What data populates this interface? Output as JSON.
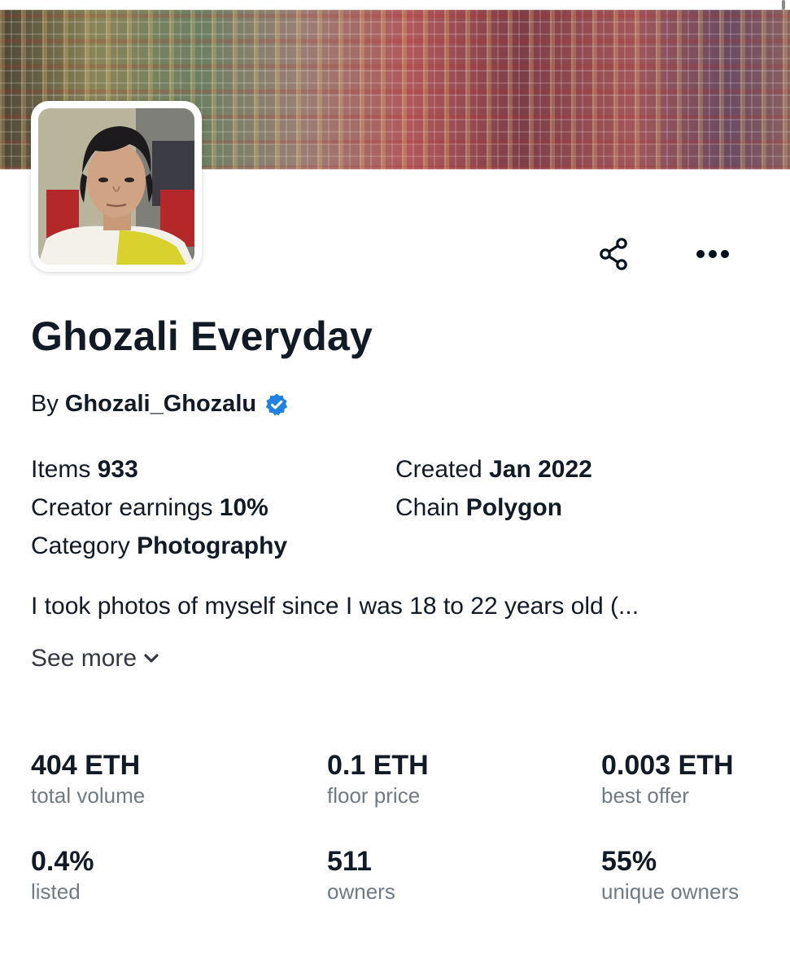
{
  "collection": {
    "title": "Ghozali Everyday",
    "by_prefix": "By",
    "creator": "Ghozali_Ghozalu",
    "verified_icon": "verified-badge-icon"
  },
  "details": {
    "items_label": "Items",
    "items_value": "933",
    "created_label": "Created",
    "created_value": "Jan 2022",
    "creator_earnings_label": "Creator earnings",
    "creator_earnings_value": "10%",
    "chain_label": "Chain",
    "chain_value": "Polygon",
    "category_label": "Category",
    "category_value": "Photography"
  },
  "description": {
    "text": "I took photos of myself since I was 18 to 22 years old (...",
    "see_more_label": "See more"
  },
  "actions": {
    "share_icon": "share-icon",
    "more_icon": "more-options-icon"
  },
  "stats": [
    {
      "value": "404 ETH",
      "label": "total volume"
    },
    {
      "value": "0.1 ETH",
      "label": "floor price"
    },
    {
      "value": "0.003 ETH",
      "label": "best offer"
    },
    {
      "value": "0.4%",
      "label": "listed"
    },
    {
      "value": "511",
      "label": "owners"
    },
    {
      "value": "55%",
      "label": "unique owners"
    }
  ],
  "colors": {
    "text_primary": "#121a26",
    "text_secondary": "#707a83",
    "verified_blue": "#2081e2"
  }
}
